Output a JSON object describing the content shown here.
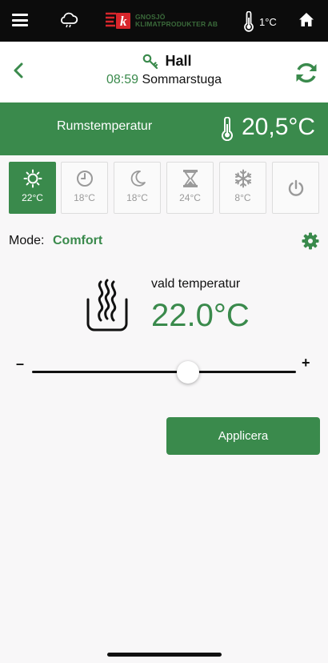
{
  "topbar": {
    "logo_text_line1": "GNOSJÖ",
    "logo_text_line2": "KLIMATPRODUKTER AB",
    "logo_letter": "k",
    "outside_temp": "1°C",
    "icons": [
      "menu-icon",
      "cloud-icon",
      "thermometer-icon",
      "home-icon"
    ]
  },
  "header": {
    "room": "Hall",
    "time": "08:59",
    "place": "Sommarstuga",
    "icons": [
      "back-icon",
      "key-icon",
      "refresh-icon"
    ]
  },
  "room_temperature": {
    "label": "Rumstemperatur",
    "value": "20,5°C"
  },
  "modes": [
    {
      "name": "comfort",
      "icon": "sun-icon",
      "temp": "22°C",
      "active": true
    },
    {
      "name": "schedule",
      "icon": "clock-icon",
      "temp": "18°C",
      "active": false
    },
    {
      "name": "night",
      "icon": "moon-icon",
      "temp": "18°C",
      "active": false
    },
    {
      "name": "timer",
      "icon": "hourglass-icon",
      "temp": "24°C",
      "active": false
    },
    {
      "name": "frost",
      "icon": "snowflake-icon",
      "temp": "8°C",
      "active": false
    },
    {
      "name": "off",
      "icon": "power-icon",
      "temp": "",
      "active": false
    }
  ],
  "mode": {
    "label": "Mode:",
    "value": "Comfort"
  },
  "chosen": {
    "label": "vald temperatur",
    "value": "22.0°C"
  },
  "slider": {
    "minus": "–",
    "plus": "+",
    "position_fraction": 0.59
  },
  "apply_label": "Applicera",
  "colors": {
    "accent": "#3a8a4c",
    "topbar": "#0c0c0c",
    "logo_red": "#d8262c",
    "inactive_icon": "#9a9a9a"
  }
}
